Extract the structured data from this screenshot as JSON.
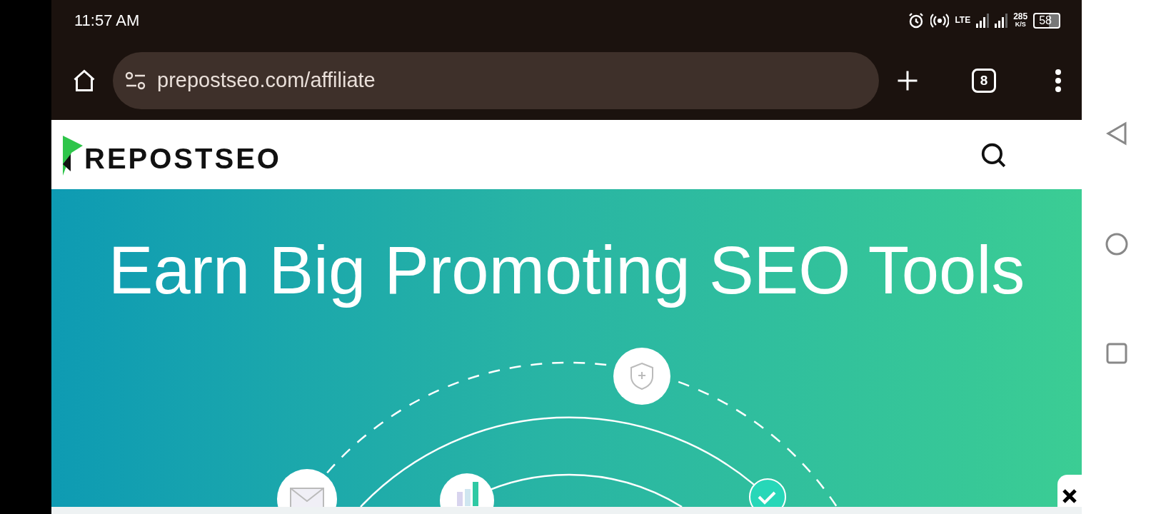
{
  "status_bar": {
    "time": "11:57 AM",
    "network": "LTE",
    "speed": "285",
    "speed_unit": "K/S",
    "battery": "58"
  },
  "browser": {
    "url": "prepostseo.com/affiliate",
    "tab_count": "8"
  },
  "site": {
    "logo_text": "REPOSTSEO"
  },
  "hero": {
    "title": "Earn Big Promoting SEO Tools"
  }
}
